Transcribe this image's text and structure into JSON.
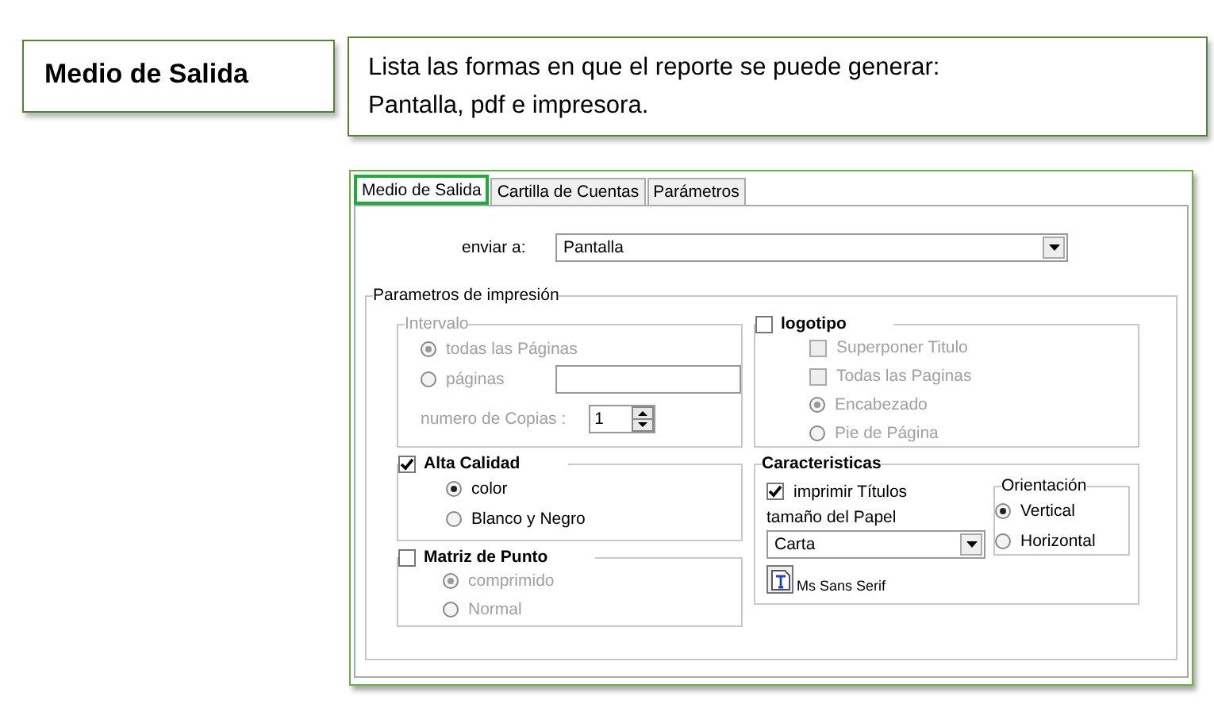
{
  "title_card": {
    "label": "Medio de Salida"
  },
  "description_card": {
    "text": "Lista las formas en que el reporte se puede generar:\nPantalla, pdf e impresora."
  },
  "tabs": [
    {
      "label": "Medio de Salida",
      "selected": true
    },
    {
      "label": "Cartilla de Cuentas",
      "selected": false
    },
    {
      "label": "Parámetros",
      "selected": false
    }
  ],
  "send_to": {
    "label": "enviar a:",
    "value": "Pantalla"
  },
  "print_params": {
    "title": "Parametros de impresión",
    "interval": {
      "title": "Intervalo",
      "disabled": true,
      "options": [
        {
          "label": "todas las Páginas",
          "selected": true
        },
        {
          "label": "páginas",
          "selected": false
        }
      ],
      "copies": {
        "label": "numero de Copias :",
        "value": "1"
      }
    },
    "quality": {
      "title": "Alta Calidad",
      "checked": true,
      "options": [
        {
          "label": "color",
          "selected": true
        },
        {
          "label": "Blanco y Negro",
          "selected": false
        }
      ]
    },
    "dot_matrix": {
      "title": "Matriz de Punto",
      "checked": false,
      "options": [
        {
          "label": "comprimido",
          "selected": true
        },
        {
          "label": "Normal",
          "selected": false
        }
      ]
    },
    "logo": {
      "title": "logotipo",
      "checked": false,
      "options": [
        {
          "kind": "checkbox",
          "label": "Superponer Titulo",
          "checked": false
        },
        {
          "kind": "checkbox",
          "label": "Todas las Paginas",
          "checked": false
        },
        {
          "kind": "radio",
          "label": "Encabezado",
          "selected": true
        },
        {
          "kind": "radio",
          "label": "Pie de Página",
          "selected": false
        }
      ]
    },
    "features": {
      "title": "Caracteristicas",
      "print_titles": {
        "label": "imprimir Títulos",
        "checked": true
      },
      "paper_size": {
        "label": "tamaño del Papel",
        "value": "Carta"
      },
      "font": {
        "label": "Ms Sans Serif"
      },
      "orientation": {
        "title": "Orientación",
        "options": [
          {
            "label": "Vertical",
            "selected": true
          },
          {
            "label": "Horizontal",
            "selected": false
          }
        ]
      }
    }
  }
}
